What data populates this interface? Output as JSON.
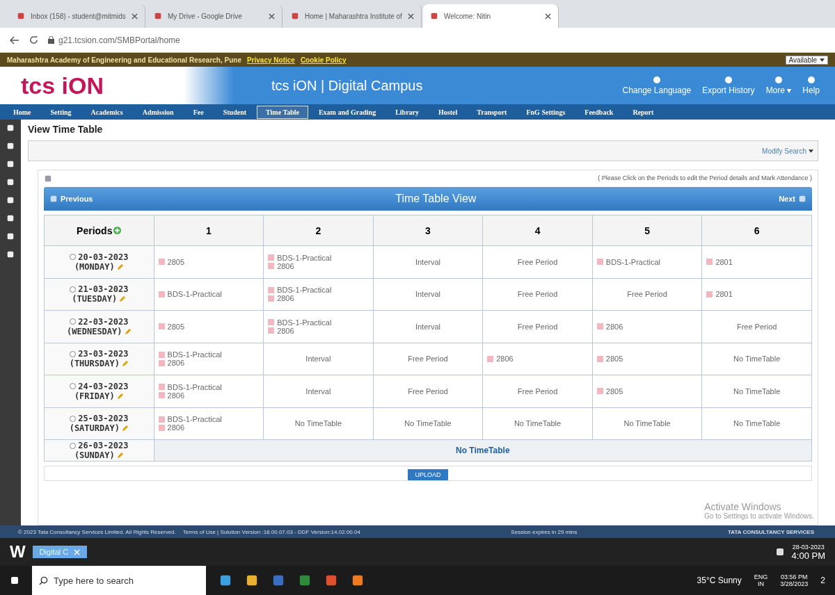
{
  "browser_tabs": [
    {
      "title": "Inbox (158) - student@mitmids",
      "selected": false
    },
    {
      "title": "My Drive - Google Drive",
      "selected": false
    },
    {
      "title": "Home | Maharashtra Institute of",
      "selected": false
    },
    {
      "title": "Welcome: Nitin",
      "selected": true
    }
  ],
  "address": "g21.tcsion.com/SMBPortal/home",
  "org_bar": {
    "name": "Maharashtra Academy of Engineering and Educational Research, Pune",
    "links": [
      "Privacy Notice",
      "Cookie Policy"
    ],
    "status": "Available"
  },
  "header": {
    "logo": "tcs iON",
    "title": "tcs iON | Digital Campus",
    "actions": [
      "Change Language",
      "Export History",
      "More ▾",
      "Help"
    ]
  },
  "nav": [
    {
      "label": "Home",
      "selected": false
    },
    {
      "label": "Setting",
      "selected": false
    },
    {
      "label": "Academics",
      "selected": false
    },
    {
      "label": "Admission",
      "selected": false
    },
    {
      "label": "Fee",
      "selected": false
    },
    {
      "label": "Student",
      "selected": false
    },
    {
      "label": "Time Table",
      "selected": true
    },
    {
      "label": "Exam and Grading",
      "selected": false
    },
    {
      "label": "Library",
      "selected": false
    },
    {
      "label": "Hostel",
      "selected": false
    },
    {
      "label": "Transport",
      "selected": false
    },
    {
      "label": "FnG Settings",
      "selected": false
    },
    {
      "label": "Feedback",
      "selected": false
    },
    {
      "label": "Report",
      "selected": false
    }
  ],
  "page_title": "View Time Table",
  "modify_search": "Modify Search",
  "hint": "( Please Click on the Periods to edit the Period details and Mark Attendance )",
  "timetable": {
    "title": "Time Table View",
    "previous": "Previous",
    "next": "Next",
    "columns": [
      "Periods",
      "1",
      "2",
      "3",
      "4",
      "5",
      "6"
    ],
    "rows": [
      {
        "cells": [
          {
            "kind": "day",
            "date": "20-03-2023",
            "day": "(MONDAY)",
            "selected": false
          },
          {
            "kind": "periods",
            "items": [
              "2805"
            ]
          },
          {
            "kind": "periods",
            "items": [
              "BDS-1-Practical",
              "2806"
            ]
          },
          {
            "kind": "note",
            "text": "Interval"
          },
          {
            "kind": "note",
            "text": "Free Period"
          },
          {
            "kind": "periods",
            "items": [
              "BDS-1-Practical"
            ]
          },
          {
            "kind": "periods",
            "items": [
              "2801"
            ]
          }
        ]
      },
      {
        "cells": [
          {
            "kind": "day",
            "date": "21-03-2023",
            "day": "(TUESDAY)",
            "selected": false
          },
          {
            "kind": "periods",
            "items": [
              "BDS-1-Practical"
            ]
          },
          {
            "kind": "periods",
            "items": [
              "BDS-1-Practical",
              "2806"
            ]
          },
          {
            "kind": "note",
            "text": "Interval"
          },
          {
            "kind": "note",
            "text": "Free Period"
          },
          {
            "kind": "note",
            "text": "Free Period"
          },
          {
            "kind": "periods",
            "items": [
              "2801"
            ]
          }
        ]
      },
      {
        "cells": [
          {
            "kind": "day",
            "date": "22-03-2023",
            "day": "(WEDNESDAY)",
            "selected": false
          },
          {
            "kind": "periods",
            "items": [
              "2805"
            ]
          },
          {
            "kind": "periods",
            "items": [
              "BDS-1-Practical",
              "2806"
            ]
          },
          {
            "kind": "note",
            "text": "Interval"
          },
          {
            "kind": "note",
            "text": "Free Period"
          },
          {
            "kind": "periods",
            "items": [
              "2806"
            ]
          },
          {
            "kind": "note",
            "text": "Free Period"
          }
        ]
      },
      {
        "cells": [
          {
            "kind": "day",
            "date": "23-03-2023",
            "day": "(THURSDAY)",
            "selected": false
          },
          {
            "kind": "periods",
            "items": [
              "BDS-1-Practical",
              "2806"
            ]
          },
          {
            "kind": "note",
            "text": "Interval"
          },
          {
            "kind": "note",
            "text": "Free Period"
          },
          {
            "kind": "periods",
            "items": [
              "2806"
            ]
          },
          {
            "kind": "periods",
            "items": [
              "2805"
            ]
          },
          {
            "kind": "note",
            "text": "No TimeTable"
          }
        ]
      },
      {
        "cells": [
          {
            "kind": "day",
            "date": "24-03-2023",
            "day": "(FRIDAY)",
            "selected": false
          },
          {
            "kind": "periods",
            "items": [
              "BDS-1-Practical",
              "2806"
            ]
          },
          {
            "kind": "note",
            "text": "Interval"
          },
          {
            "kind": "note",
            "text": "Free Period"
          },
          {
            "kind": "note",
            "text": "Free Period"
          },
          {
            "kind": "periods",
            "items": [
              "2805"
            ]
          },
          {
            "kind": "note",
            "text": "No TimeTable"
          }
        ]
      },
      {
        "cells": [
          {
            "kind": "day",
            "date": "25-03-2023",
            "day": "(SATURDAY)",
            "selected": false
          },
          {
            "kind": "periods",
            "items": [
              "BDS-1-Practical",
              "2806"
            ]
          },
          {
            "kind": "note",
            "text": "No TimeTable"
          },
          {
            "kind": "note",
            "text": "No TimeTable"
          },
          {
            "kind": "note",
            "text": "No TimeTable"
          },
          {
            "kind": "note",
            "text": "No TimeTable"
          },
          {
            "kind": "note",
            "text": "No TimeTable"
          }
        ]
      },
      {
        "cells": [
          {
            "kind": "day",
            "date": "26-03-2023",
            "day": "(SUNDAY)",
            "selected": false
          },
          {
            "kind": "span",
            "text": "No TimeTable",
            "colspan": 6
          }
        ]
      }
    ]
  },
  "upload": "UPLOAD",
  "footer": {
    "copyright": "© 2023 Tata Consultancy Services Limited. All Rights Reserved.",
    "terms": "Terms of Use | Solution Version :18.00.07.03 - DDF Version:14.02.00.04",
    "session": "Session expires in 29 mins",
    "brand": "TATA CONSULTANCY SERVICES"
  },
  "activation": {
    "title": "Activate Windows",
    "subtitle": "Go to Settings to activate Windows."
  },
  "app_bar": {
    "logo": "W",
    "tab": "Digital C",
    "date": "28-03-2023",
    "time": "4:00 PM"
  },
  "taskbar": {
    "search": "Type here to search",
    "weather": "35°C  Sunny",
    "lang": "ENG",
    "region": "IN",
    "time": "03:56 PM",
    "date": "3/28/2023",
    "notifications": "2"
  }
}
